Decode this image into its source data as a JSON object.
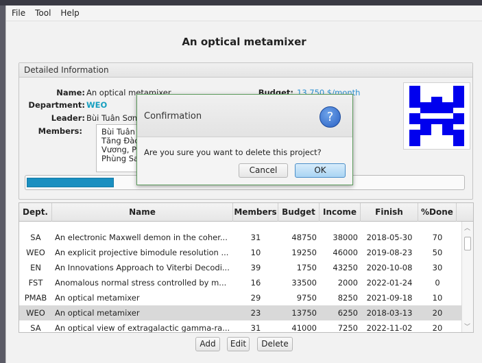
{
  "menu": [
    "File",
    "Tool",
    "Help"
  ],
  "title": "An optical metamixer",
  "detail": {
    "header": "Detailed Information",
    "name_label": "Name:",
    "name_value": "An optical metamixer",
    "budget_label": "Budget:",
    "budget_value": "13,750 $/month",
    "department_label": "Department:",
    "department_value": "WEO",
    "leader_label": "Leader:",
    "leader_value": "Bùi Tuân Sơn",
    "members_label": "Members:",
    "members": [
      "Bùi Tuân Sơ",
      "Tăng Đào H",
      "Vương, Phù",
      "Phùng Sa Đ"
    ],
    "progress_fraction": 0.2
  },
  "table": {
    "columns": [
      "Dept.",
      "Name",
      "Members",
      "Budget",
      "Income",
      "Finish",
      "%Done"
    ],
    "rows": [
      {
        "dept": "SA",
        "name": "An electronic Maxwell demon in the coher...",
        "members": "31",
        "budget": "48750",
        "income": "38000",
        "finish": "2018-05-30",
        "done": "70"
      },
      {
        "dept": "WEO",
        "name": "An explicit projective bimodule resolution ...",
        "members": "10",
        "budget": "19250",
        "income": "46000",
        "finish": "2019-08-23",
        "done": "50"
      },
      {
        "dept": "EN",
        "name": "An Innovations Approach to Viterbi Decodi...",
        "members": "39",
        "budget": "1750",
        "income": "43250",
        "finish": "2020-10-08",
        "done": "30"
      },
      {
        "dept": "FST",
        "name": "Anomalous normal stress controlled by m...",
        "members": "16",
        "budget": "33500",
        "income": "2000",
        "finish": "2022-01-24",
        "done": "0"
      },
      {
        "dept": "PMAB",
        "name": "An optical metamixer",
        "members": "29",
        "budget": "9750",
        "income": "8250",
        "finish": "2021-09-18",
        "done": "10"
      },
      {
        "dept": "WEO",
        "name": "An optical metamixer",
        "members": "23",
        "budget": "13750",
        "income": "6250",
        "finish": "2018-03-13",
        "done": "20"
      },
      {
        "dept": "SA",
        "name": "An optical view of extragalactic gamma-ra...",
        "members": "31",
        "budget": "41000",
        "income": "7250",
        "finish": "2022-11-02",
        "done": "20"
      }
    ],
    "selected_row": 5
  },
  "buttons": {
    "add": "Add",
    "edit": "Edit",
    "delete": "Delete"
  },
  "dialog": {
    "title": "Confirmation",
    "icon": "question-icon",
    "icon_glyph": "?",
    "message": "Are you sure you want to delete this project?",
    "cancel": "Cancel",
    "ok": "OK"
  },
  "colors": {
    "accent": "#1a8fc0",
    "budget_text": "#2a8fd0",
    "department_text": "#18a0c0",
    "avatar": "#0000ee"
  }
}
